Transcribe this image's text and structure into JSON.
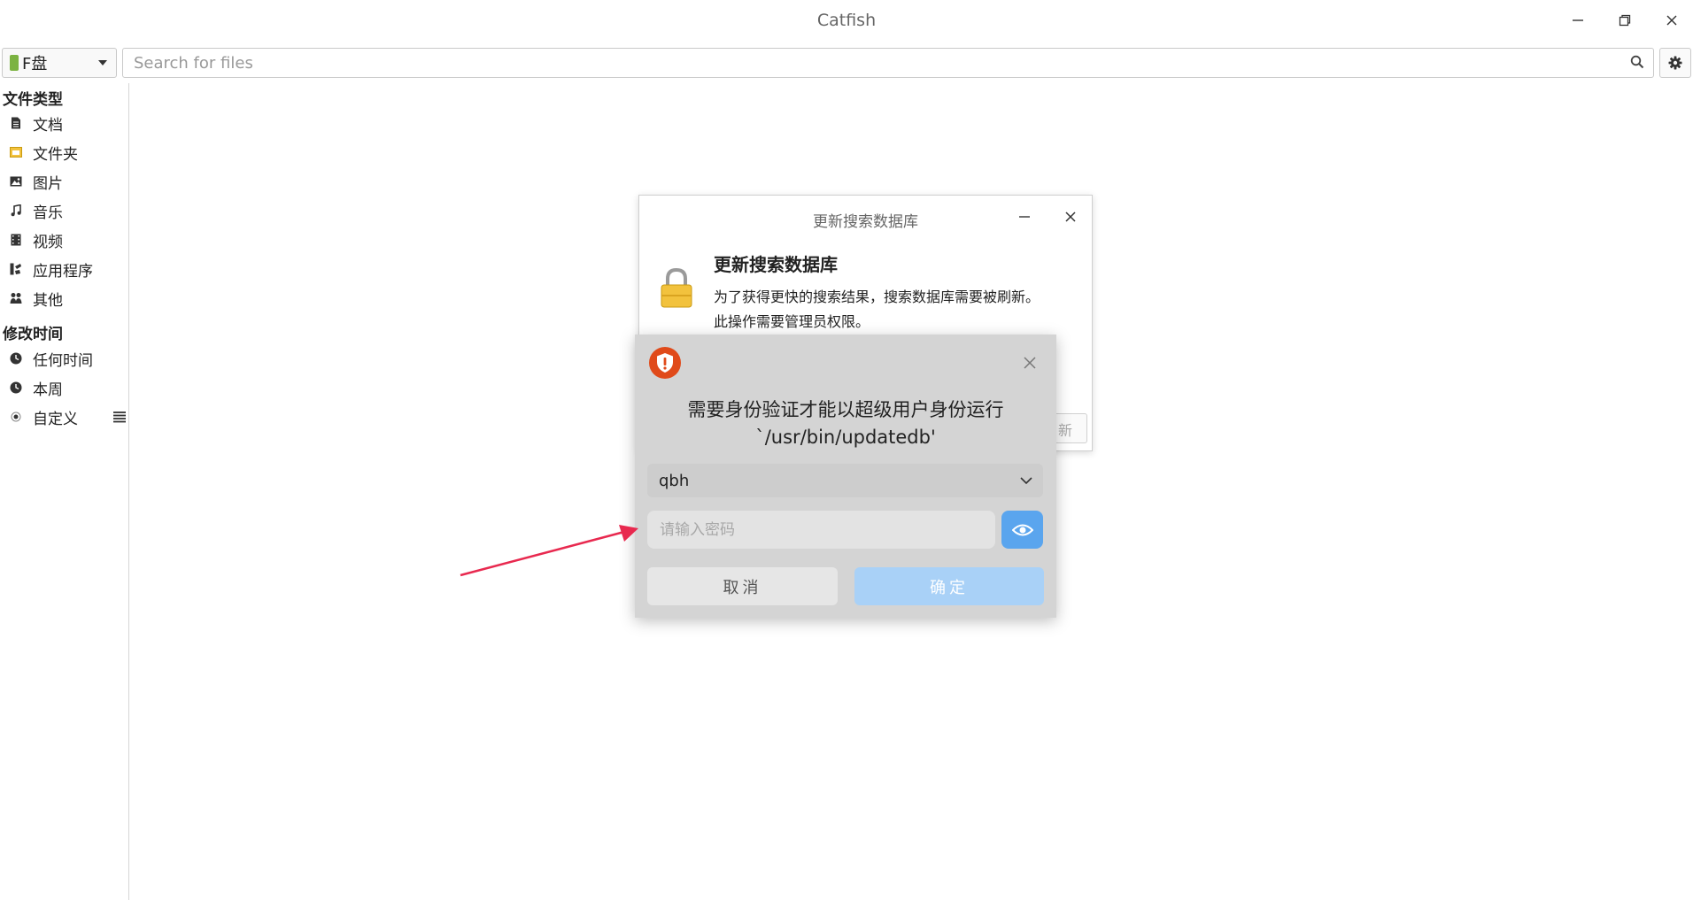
{
  "window": {
    "title": "Catfish"
  },
  "toolbar": {
    "location_label": "F盘",
    "search_placeholder": "Search for files"
  },
  "sidebar": {
    "file_type_header": "文件类型",
    "file_types": [
      {
        "label": "文档",
        "icon": "document-icon"
      },
      {
        "label": "文件夹",
        "icon": "folder-icon"
      },
      {
        "label": "图片",
        "icon": "image-icon"
      },
      {
        "label": "音乐",
        "icon": "music-icon"
      },
      {
        "label": "视频",
        "icon": "video-icon"
      },
      {
        "label": "应用程序",
        "icon": "application-icon"
      },
      {
        "label": "其他",
        "icon": "other-icon"
      }
    ],
    "modified_header": "修改时间",
    "modified": [
      {
        "label": "任何时间",
        "icon": "clock-icon"
      },
      {
        "label": "本周",
        "icon": "clock-icon"
      },
      {
        "label": "自定义",
        "icon": "radio-icon"
      }
    ]
  },
  "update_dialog": {
    "window_title": "更新搜索数据库",
    "heading": "更新搜索数据库",
    "line1": "为了获得更快的搜索结果，搜索数据库需要被刷新。",
    "line2": "此操作需要管理员权限。",
    "partial_button_text": "新"
  },
  "auth_dialog": {
    "message": "需要身份验证才能以超级用户身份运行`/usr/bin/updatedb'",
    "user": "qbh",
    "password_placeholder": "请输入密码",
    "cancel_label": "取消",
    "ok_label": "确定"
  },
  "colors": {
    "accent_blue": "#5aa5ee",
    "ok_button": "#a9d1f7",
    "shield": "#e04a1a",
    "arrow": "#e8294f",
    "drive_green": "#7cb342",
    "lock_gold": "#f2c23d"
  }
}
